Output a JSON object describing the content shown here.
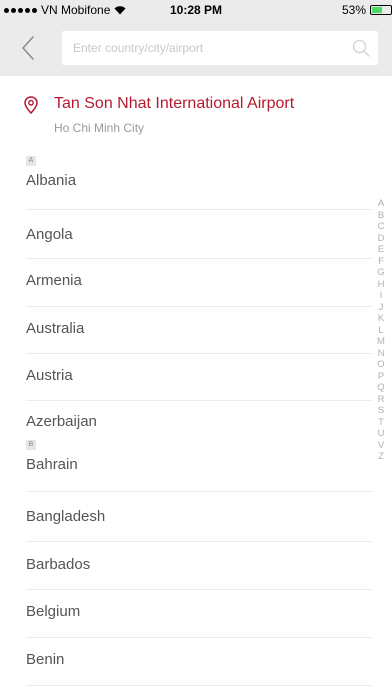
{
  "status_bar": {
    "carrier": "VN Mobifone",
    "time": "10:28 PM",
    "battery": "53%",
    "battery_level": 0.53
  },
  "header": {
    "back_icon": "chevron-left-icon",
    "search_placeholder": "Enter country/city/airport",
    "search_value": "",
    "search_icon": "search-icon"
  },
  "current_location": {
    "icon": "location-pin-icon",
    "airport": "Tan Son Nhat International Airport",
    "city": "Ho Chi Minh City"
  },
  "sections": [
    {
      "letter": "A",
      "countries": [
        "Albania",
        "Angola",
        "Armenia",
        "Australia",
        "Austria",
        "Azerbaijan"
      ]
    },
    {
      "letter": "B",
      "countries": [
        "Bahrain",
        "Bangladesh",
        "Barbados",
        "Belgium",
        "Benin"
      ]
    }
  ],
  "alphabet_index": [
    "A",
    "B",
    "C",
    "D",
    "E",
    "F",
    "G",
    "H",
    "I",
    "J",
    "K",
    "L",
    "M",
    "N",
    "O",
    "P",
    "Q",
    "R",
    "S",
    "T",
    "U",
    "V",
    "Z"
  ],
  "colors": {
    "accent": "#b5192f",
    "header_bg": "#ebebeb",
    "battery": "#4cd964"
  }
}
